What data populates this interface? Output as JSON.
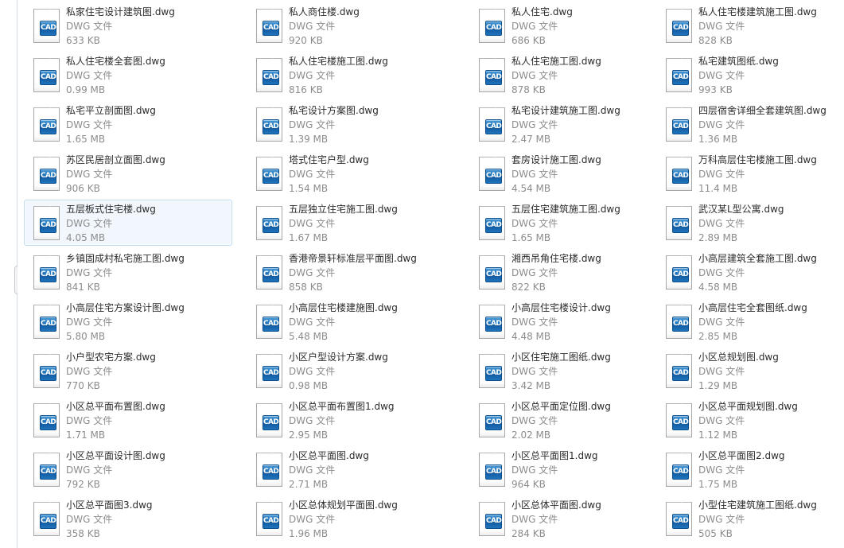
{
  "window": {
    "view_mode": "tiles",
    "icon_label": "cad-file-icon",
    "icon_badge_text": "CAD",
    "selection_color": "#f2f7fd",
    "selection_border_color": "#bfdcf4",
    "text_color": "#2b2b2b",
    "meta_text_color": "#8c8c8c"
  },
  "columns": 4,
  "files": [
    {
      "name": "私家住宅设计建筑图.dwg",
      "type": "DWG 文件",
      "size": "633 KB",
      "selected": false
    },
    {
      "name": "私人商住楼.dwg",
      "type": "DWG 文件",
      "size": "920 KB",
      "selected": false
    },
    {
      "name": "私人住宅.dwg",
      "type": "DWG 文件",
      "size": "686 KB",
      "selected": false
    },
    {
      "name": "私人住宅楼建筑施工图.dwg",
      "type": "DWG 文件",
      "size": "828 KB",
      "selected": false
    },
    {
      "name": "私人住宅楼全套图.dwg",
      "type": "DWG 文件",
      "size": "0.99 MB",
      "selected": false
    },
    {
      "name": "私人住宅楼施工图.dwg",
      "type": "DWG 文件",
      "size": "816 KB",
      "selected": false
    },
    {
      "name": "私人住宅施工图.dwg",
      "type": "DWG 文件",
      "size": "878 KB",
      "selected": false
    },
    {
      "name": "私宅建筑图纸.dwg",
      "type": "DWG 文件",
      "size": "993 KB",
      "selected": false
    },
    {
      "name": "私宅平立剖面图.dwg",
      "type": "DWG 文件",
      "size": "1.65 MB",
      "selected": false
    },
    {
      "name": "私宅设计方案图.dwg",
      "type": "DWG 文件",
      "size": "1.39 MB",
      "selected": false
    },
    {
      "name": "私宅设计建筑施工图.dwg",
      "type": "DWG 文件",
      "size": "2.47 MB",
      "selected": false
    },
    {
      "name": "四层宿舍详细全套建筑图.dwg",
      "type": "DWG 文件",
      "size": "1.36 MB",
      "selected": false
    },
    {
      "name": "苏区民居剖立面图.dwg",
      "type": "DWG 文件",
      "size": "906 KB",
      "selected": false
    },
    {
      "name": "塔式住宅户型.dwg",
      "type": "DWG 文件",
      "size": "1.54 MB",
      "selected": false
    },
    {
      "name": "套房设计施工图.dwg",
      "type": "DWG 文件",
      "size": "4.54 MB",
      "selected": false
    },
    {
      "name": "万科高层住宅楼施工图.dwg",
      "type": "DWG 文件",
      "size": "11.4 MB",
      "selected": false
    },
    {
      "name": "五层板式住宅楼.dwg",
      "type": "DWG 文件",
      "size": "4.05 MB",
      "selected": true
    },
    {
      "name": "五层独立住宅施工图.dwg",
      "type": "DWG 文件",
      "size": "1.67 MB",
      "selected": false
    },
    {
      "name": "五层住宅建筑施工图.dwg",
      "type": "DWG 文件",
      "size": "1.65 MB",
      "selected": false
    },
    {
      "name": "武汉某L型公寓.dwg",
      "type": "DWG 文件",
      "size": "2.89 MB",
      "selected": false
    },
    {
      "name": "乡镇固成村私宅施工图.dwg",
      "type": "DWG 文件",
      "size": "841 KB",
      "selected": false
    },
    {
      "name": "香港帝景轩标准层平面图.dwg",
      "type": "DWG 文件",
      "size": "858 KB",
      "selected": false
    },
    {
      "name": "湘西吊角住宅楼.dwg",
      "type": "DWG 文件",
      "size": "822 KB",
      "selected": false
    },
    {
      "name": "小高层建筑全套施工图.dwg",
      "type": "DWG 文件",
      "size": "4.58 MB",
      "selected": false
    },
    {
      "name": "小高层住宅方案设计图.dwg",
      "type": "DWG 文件",
      "size": "5.80 MB",
      "selected": false
    },
    {
      "name": "小高层住宅楼建施图.dwg",
      "type": "DWG 文件",
      "size": "5.48 MB",
      "selected": false
    },
    {
      "name": "小高层住宅楼设计.dwg",
      "type": "DWG 文件",
      "size": "4.48 MB",
      "selected": false
    },
    {
      "name": "小高层住宅全套图纸.dwg",
      "type": "DWG 文件",
      "size": "2.85 MB",
      "selected": false
    },
    {
      "name": "小户型农宅方案.dwg",
      "type": "DWG 文件",
      "size": "770 KB",
      "selected": false
    },
    {
      "name": "小区户型设计方案.dwg",
      "type": "DWG 文件",
      "size": "0.98 MB",
      "selected": false
    },
    {
      "name": "小区住宅施工图纸.dwg",
      "type": "DWG 文件",
      "size": "3.42 MB",
      "selected": false
    },
    {
      "name": "小区总规划图.dwg",
      "type": "DWG 文件",
      "size": "1.29 MB",
      "selected": false
    },
    {
      "name": "小区总平面布置图.dwg",
      "type": "DWG 文件",
      "size": "1.71 MB",
      "selected": false
    },
    {
      "name": "小区总平面布置图1.dwg",
      "type": "DWG 文件",
      "size": "2.95 MB",
      "selected": false
    },
    {
      "name": "小区总平面定位图.dwg",
      "type": "DWG 文件",
      "size": "2.02 MB",
      "selected": false
    },
    {
      "name": "小区总平面规划图.dwg",
      "type": "DWG 文件",
      "size": "1.12 MB",
      "selected": false
    },
    {
      "name": "小区总平面设计图.dwg",
      "type": "DWG 文件",
      "size": "792 KB",
      "selected": false
    },
    {
      "name": "小区总平面图.dwg",
      "type": "DWG 文件",
      "size": "2.71 MB",
      "selected": false
    },
    {
      "name": "小区总平面图1.dwg",
      "type": "DWG 文件",
      "size": "964 KB",
      "selected": false
    },
    {
      "name": "小区总平面图2.dwg",
      "type": "DWG 文件",
      "size": "1.75 MB",
      "selected": false
    },
    {
      "name": "小区总平面图3.dwg",
      "type": "DWG 文件",
      "size": "358 KB",
      "selected": false
    },
    {
      "name": "小区总体规划平面图.dwg",
      "type": "DWG 文件",
      "size": "1.96 MB",
      "selected": false
    },
    {
      "name": "小区总体平面图.dwg",
      "type": "DWG 文件",
      "size": "284 KB",
      "selected": false
    },
    {
      "name": "小型住宅建筑施工图纸.dwg",
      "type": "DWG 文件",
      "size": "505 KB",
      "selected": false
    }
  ]
}
